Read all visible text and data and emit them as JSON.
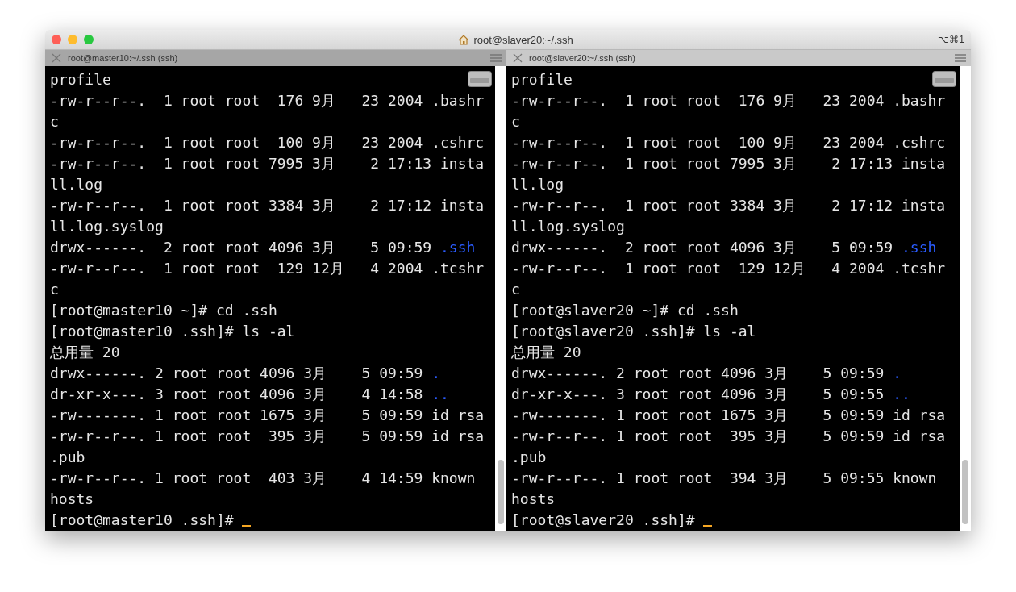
{
  "window": {
    "title": "root@slaver20:~/.ssh",
    "shortcut": "⌥⌘1"
  },
  "panes": [
    {
      "title": "root@master10:~/.ssh (ssh)",
      "active": false,
      "cursor": true,
      "lines": [
        {
          "text": "profile"
        },
        {
          "text": "-rw-r--r--.  1 root root  176 9月   23 2004 .bashr"
        },
        {
          "text": "c"
        },
        {
          "text": "-rw-r--r--.  1 root root  100 9月   23 2004 .cshrc"
        },
        {
          "text": "-rw-r--r--.  1 root root 7995 3月    2 17:13 insta"
        },
        {
          "text": "ll.log"
        },
        {
          "text": "-rw-r--r--.  1 root root 3384 3月    2 17:12 insta"
        },
        {
          "text": "ll.log.syslog"
        },
        {
          "text": "drwx------.  2 root root 4096 3月    5 09:59 ",
          "dir": ".ssh"
        },
        {
          "text": "-rw-r--r--.  1 root root  129 12月   4 2004 .tcshr"
        },
        {
          "text": "c"
        },
        {
          "text": "[root@master10 ~]# cd .ssh"
        },
        {
          "text": "[root@master10 .ssh]# ls -al"
        },
        {
          "text": "总用量 20"
        },
        {
          "text": "drwx------. 2 root root 4096 3月    5 09:59 ",
          "dir": "."
        },
        {
          "text": "dr-xr-x---. 3 root root 4096 3月    4 14:58 ",
          "dir": ".."
        },
        {
          "text": "-rw-------. 1 root root 1675 3月    5 09:59 id_rsa"
        },
        {
          "text": "-rw-r--r--. 1 root root  395 3月    5 09:59 id_rsa"
        },
        {
          "text": ".pub"
        },
        {
          "text": "-rw-r--r--. 1 root root  403 3月    4 14:59 known_"
        },
        {
          "text": "hosts"
        },
        {
          "text": "[root@master10 .ssh]# "
        }
      ]
    },
    {
      "title": "root@slaver20:~/.ssh (ssh)",
      "active": true,
      "cursor": true,
      "lines": [
        {
          "text": "profile"
        },
        {
          "text": "-rw-r--r--.  1 root root  176 9月   23 2004 .bashr"
        },
        {
          "text": "c"
        },
        {
          "text": "-rw-r--r--.  1 root root  100 9月   23 2004 .cshrc"
        },
        {
          "text": "-rw-r--r--.  1 root root 7995 3月    2 17:13 insta"
        },
        {
          "text": "ll.log"
        },
        {
          "text": "-rw-r--r--.  1 root root 3384 3月    2 17:12 insta"
        },
        {
          "text": "ll.log.syslog"
        },
        {
          "text": "drwx------.  2 root root 4096 3月    5 09:59 ",
          "dir": ".ssh"
        },
        {
          "text": "-rw-r--r--.  1 root root  129 12月   4 2004 .tcshr"
        },
        {
          "text": "c"
        },
        {
          "text": "[root@slaver20 ~]# cd .ssh"
        },
        {
          "text": "[root@slaver20 .ssh]# ls -al"
        },
        {
          "text": "总用量 20"
        },
        {
          "text": "drwx------. 2 root root 4096 3月    5 09:59 ",
          "dir": "."
        },
        {
          "text": "dr-xr-x---. 3 root root 4096 3月    5 09:55 ",
          "dir": ".."
        },
        {
          "text": "-rw-------. 1 root root 1675 3月    5 09:59 id_rsa"
        },
        {
          "text": "-rw-r--r--. 1 root root  395 3月    5 09:59 id_rsa"
        },
        {
          "text": ".pub"
        },
        {
          "text": "-rw-r--r--. 1 root root  394 3月    5 09:55 known_"
        },
        {
          "text": "hosts"
        },
        {
          "text": "[root@slaver20 .ssh]# "
        }
      ]
    }
  ]
}
